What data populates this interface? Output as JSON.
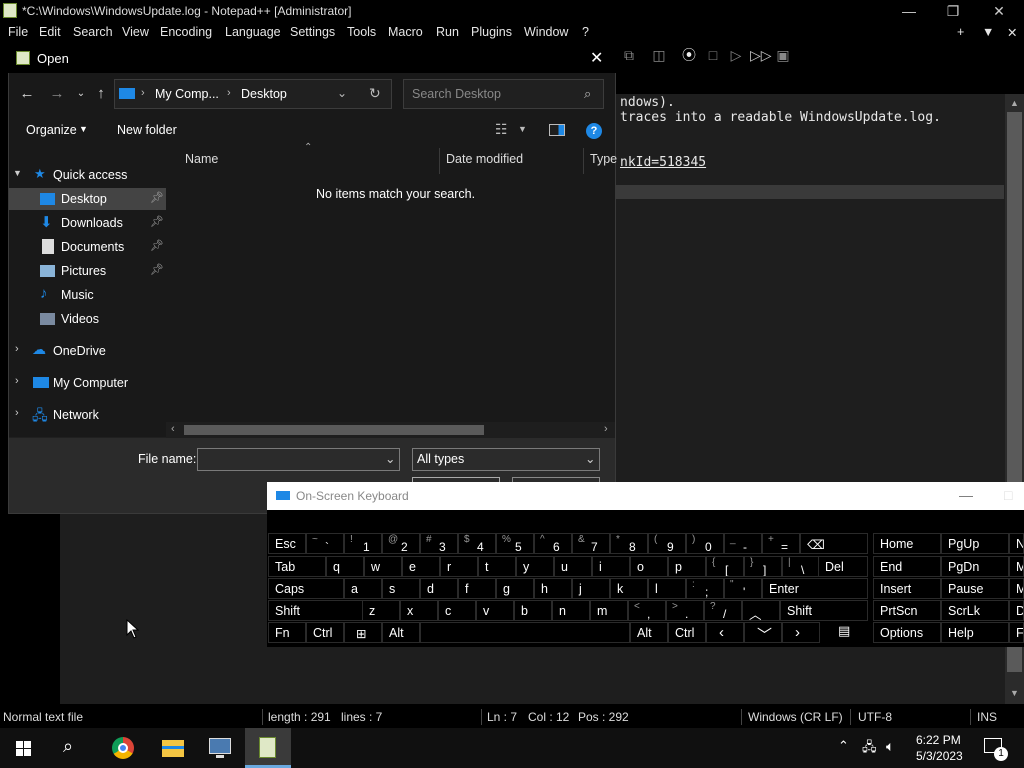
{
  "npp": {
    "title": "*C:\\Windows\\WindowsUpdate.log - Notepad++ [Administrator]",
    "menu": [
      "File",
      "Edit",
      "Search",
      "View",
      "Encoding",
      "Language",
      "Settings",
      "Tools",
      "Macro",
      "Run",
      "Plugins",
      "Window",
      "?"
    ],
    "editor_lines": [
      "ndows).",
      "traces into a readable WindowsUpdate.log.",
      "nkId=518345"
    ],
    "status": {
      "type": "Normal text file",
      "length": "length : 291",
      "lines": "lines : 7",
      "ln": "Ln : 7",
      "col": "Col : 12",
      "pos": "Pos : 292",
      "eol": "Windows (CR LF)",
      "encoding": "UTF-8",
      "mode": "INS"
    }
  },
  "dialog": {
    "title": "Open",
    "address": {
      "root": "My Comp...",
      "current": "Desktop"
    },
    "search_placeholder": "Search Desktop",
    "organize": "Organize",
    "new_folder": "New folder",
    "nav": {
      "quick_access": "Quick access",
      "desktop": "Desktop",
      "downloads": "Downloads",
      "documents": "Documents",
      "pictures": "Pictures",
      "music": "Music",
      "videos": "Videos",
      "onedrive": "OneDrive",
      "my_computer": "My Computer",
      "network": "Network"
    },
    "columns": {
      "name": "Name",
      "date": "Date modified",
      "type": "Type"
    },
    "empty_message": "No items match your search.",
    "file_name_label": "File name:",
    "file_name_value": "",
    "file_type": "All types"
  },
  "osk": {
    "title": "On-Screen Keyboard",
    "rows": {
      "r1": [
        [
          "Esc",
          ""
        ],
        [
          "~",
          "`"
        ],
        [
          "!",
          "1"
        ],
        [
          "@",
          "2"
        ],
        [
          "#",
          "3"
        ],
        [
          "$",
          "4"
        ],
        [
          "%",
          "5"
        ],
        [
          "^",
          "6"
        ],
        [
          "&",
          "7"
        ],
        [
          "*",
          "8"
        ],
        [
          "(",
          "9"
        ],
        [
          ")",
          "0"
        ],
        [
          "_",
          "-"
        ],
        [
          "+",
          "="
        ]
      ],
      "r2": [
        "Tab",
        "q",
        "w",
        "e",
        "r",
        "t",
        "y",
        "u",
        "i",
        "o",
        "p"
      ],
      "r2b": [
        [
          "{",
          "["
        ],
        [
          "}",
          "]"
        ],
        [
          "|",
          "\\"
        ]
      ],
      "r2c": "Del",
      "r3": [
        "Caps",
        "a",
        "s",
        "d",
        "f",
        "g",
        "h",
        "j",
        "k",
        "l"
      ],
      "r3b": [
        [
          ":",
          ";"
        ],
        [
          "\"",
          "'"
        ]
      ],
      "r3c": "Enter",
      "r4": [
        "Shift",
        "z",
        "x",
        "c",
        "v",
        "b",
        "n",
        "m"
      ],
      "r4b": [
        [
          "<",
          ","
        ],
        [
          ">",
          "."
        ],
        [
          "?",
          "/"
        ]
      ],
      "r4c": "Shift",
      "r5": [
        "Fn",
        "Ctrl",
        "Alt",
        "Alt",
        "Ctrl"
      ]
    },
    "side": [
      [
        "Home",
        "PgUp",
        "N"
      ],
      [
        "End",
        "PgDn",
        "M"
      ],
      [
        "Insert",
        "Pause",
        "M"
      ],
      [
        "PrtScn",
        "ScrLk",
        "D"
      ],
      [
        "Options",
        "Help",
        "Fa"
      ]
    ]
  },
  "taskbar": {
    "time": "6:22 PM",
    "date": "5/3/2023",
    "notifications": "1"
  }
}
